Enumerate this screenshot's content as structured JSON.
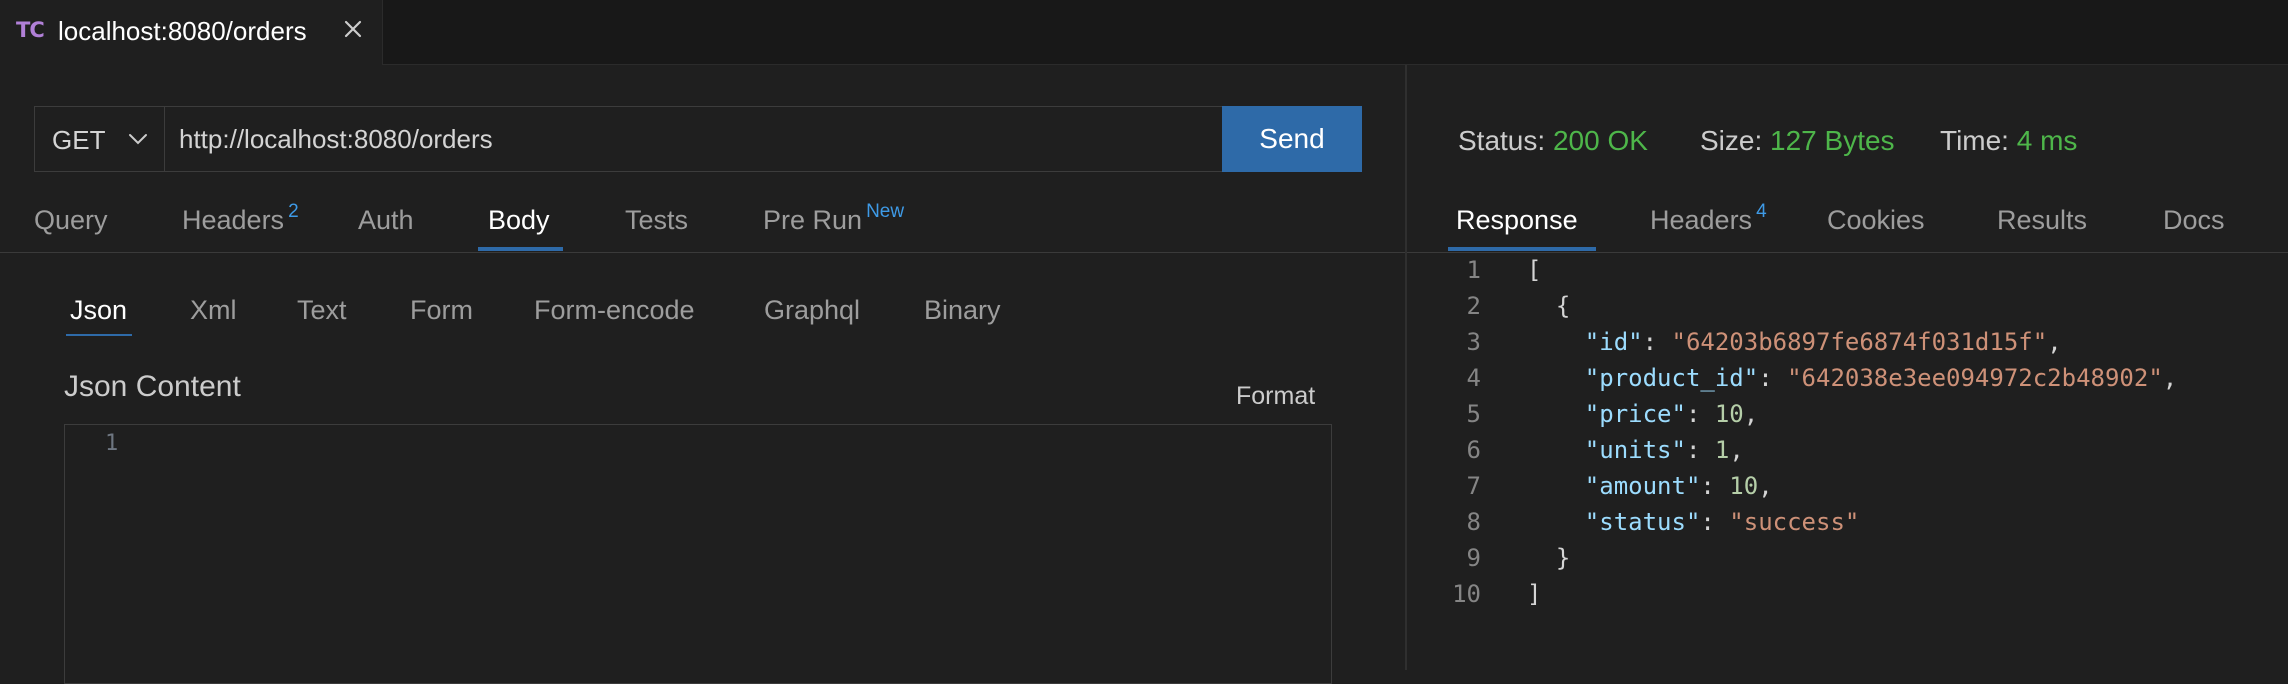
{
  "tab": {
    "logo": "TC",
    "title": "localhost:8080/orders"
  },
  "request": {
    "method": "GET",
    "url": "http://localhost:8080/orders",
    "send_label": "Send",
    "tabs": [
      {
        "label": "Query",
        "badge": ""
      },
      {
        "label": "Headers",
        "badge": "2"
      },
      {
        "label": "Auth",
        "badge": ""
      },
      {
        "label": "Body",
        "badge": ""
      },
      {
        "label": "Tests",
        "badge": ""
      },
      {
        "label": "Pre Run",
        "badge": "New"
      }
    ],
    "active_tab": "Body",
    "body_tabs": [
      "Json",
      "Xml",
      "Text",
      "Form",
      "Form-encode",
      "Graphql",
      "Binary"
    ],
    "active_body_tab": "Json",
    "json_content_label": "Json Content",
    "format_label": "Format",
    "editor_line": "1"
  },
  "response": {
    "status_label": "Status:",
    "status_value": "200 OK",
    "size_label": "Size:",
    "size_value": "127 Bytes",
    "time_label": "Time:",
    "time_value": "4 ms",
    "tabs": [
      {
        "label": "Response",
        "badge": ""
      },
      {
        "label": "Headers",
        "badge": "4"
      },
      {
        "label": "Cookies",
        "badge": ""
      },
      {
        "label": "Results",
        "badge": ""
      },
      {
        "label": "Docs",
        "badge": ""
      }
    ],
    "active_tab": "Response",
    "body_lines": [
      {
        "ln": "1",
        "indent": "",
        "key": "",
        "sep": "",
        "value": "",
        "value_type": "",
        "tail": "["
      },
      {
        "ln": "2",
        "indent": "  ",
        "key": "",
        "sep": "",
        "value": "",
        "value_type": "",
        "tail": "{"
      },
      {
        "ln": "3",
        "indent": "    ",
        "key": "\"id\"",
        "sep": ": ",
        "value": "\"64203b6897fe6874f031d15f\"",
        "value_type": "string",
        "tail": ","
      },
      {
        "ln": "4",
        "indent": "    ",
        "key": "\"product_id\"",
        "sep": ": ",
        "value": "\"642038e3ee094972c2b48902\"",
        "value_type": "string",
        "tail": ","
      },
      {
        "ln": "5",
        "indent": "    ",
        "key": "\"price\"",
        "sep": ": ",
        "value": "10",
        "value_type": "number",
        "tail": ","
      },
      {
        "ln": "6",
        "indent": "    ",
        "key": "\"units\"",
        "sep": ": ",
        "value": "1",
        "value_type": "number",
        "tail": ","
      },
      {
        "ln": "7",
        "indent": "    ",
        "key": "\"amount\"",
        "sep": ": ",
        "value": "10",
        "value_type": "number",
        "tail": ","
      },
      {
        "ln": "8",
        "indent": "    ",
        "key": "\"status\"",
        "sep": ": ",
        "value": "\"success\"",
        "value_type": "string",
        "tail": ""
      },
      {
        "ln": "9",
        "indent": "  ",
        "key": "",
        "sep": "",
        "value": "",
        "value_type": "",
        "tail": "}"
      },
      {
        "ln": "10",
        "indent": "",
        "key": "",
        "sep": "",
        "value": "",
        "value_type": "",
        "tail": "]"
      }
    ]
  },
  "icons": {
    "close": "close-icon",
    "method_dropdown": "chevron-down-icon",
    "logo": "thunder-client-logo-icon"
  },
  "colors": {
    "accent": "#2e6aa8",
    "success": "#4eb64a",
    "badge": "#3e9ae6",
    "json_key": "#9cdcfe",
    "json_string": "#ce9178",
    "json_number": "#b5cea8"
  }
}
